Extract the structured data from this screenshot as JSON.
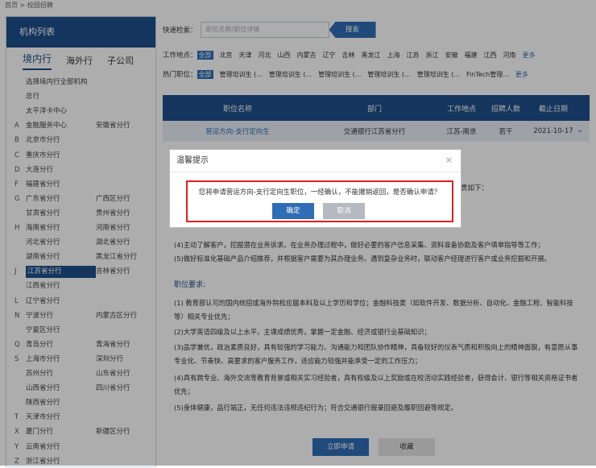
{
  "breadcrumb": "首页 > 校园招聘",
  "sidebar": {
    "title": "机构列表",
    "tabs": [
      "境内行",
      "海外行",
      "子公司"
    ],
    "rows": [
      {
        "letter": "",
        "c1": "选择境内行全部机构",
        "c2": ""
      },
      {
        "letter": "",
        "c1": "总行",
        "c2": ""
      },
      {
        "letter": "",
        "c1": "太平洋卡中心",
        "c2": ""
      },
      {
        "letter": "A",
        "c1": "金融服务中心",
        "c2": "安徽省分行"
      },
      {
        "letter": "B",
        "c1": "北京市分行",
        "c2": ""
      },
      {
        "letter": "C",
        "c1": "重庆市分行",
        "c2": ""
      },
      {
        "letter": "D",
        "c1": "大连分行",
        "c2": ""
      },
      {
        "letter": "F",
        "c1": "福建省分行",
        "c2": ""
      },
      {
        "letter": "G",
        "c1": "广东省分行",
        "c2": "广西区分行"
      },
      {
        "letter": "",
        "c1": "甘肃省分行",
        "c2": "贵州省分行"
      },
      {
        "letter": "H",
        "c1": "海南省分行",
        "c2": "河南省分行"
      },
      {
        "letter": "",
        "c1": "河北省分行",
        "c2": "湖北省分行"
      },
      {
        "letter": "",
        "c1": "湖南省分行",
        "c2": "黑龙江省分行"
      },
      {
        "letter": "J",
        "c1": "江苏省分行",
        "c2": "吉林省分行"
      },
      {
        "letter": "",
        "c1": "江西省分行",
        "c2": ""
      },
      {
        "letter": "L",
        "c1": "辽宁省分行",
        "c2": ""
      },
      {
        "letter": "N",
        "c1": "宁波分行",
        "c2": "内蒙古区分行"
      },
      {
        "letter": "",
        "c1": "宁夏区分行",
        "c2": ""
      },
      {
        "letter": "Q",
        "c1": "青岛分行",
        "c2": "青海省分行"
      },
      {
        "letter": "S",
        "c1": "上海市分行",
        "c2": "深圳分行"
      },
      {
        "letter": "",
        "c1": "苏州分行",
        "c2": "山东省分行"
      },
      {
        "letter": "",
        "c1": "山西省分行",
        "c2": "四川省分行"
      },
      {
        "letter": "",
        "c1": "陕西省分行",
        "c2": ""
      },
      {
        "letter": "T",
        "c1": "天津市分行",
        "c2": ""
      },
      {
        "letter": "X",
        "c1": "厦门分行",
        "c2": "新疆区分行"
      },
      {
        "letter": "Y",
        "c1": "云南省分行",
        "c2": ""
      },
      {
        "letter": "Z",
        "c1": "浙江省分行",
        "c2": ""
      }
    ]
  },
  "search": {
    "label": "快速检索：",
    "placeholder": "职位名称/职位详情",
    "button": "搜索"
  },
  "filters": {
    "location_label": "工作地点：",
    "locations": [
      "全部",
      "北京",
      "天津",
      "河北",
      "山西",
      "内蒙古",
      "辽宁",
      "吉林",
      "黑龙江",
      "上海",
      "江苏",
      "浙江",
      "安徽",
      "福建",
      "江西",
      "河南"
    ],
    "hot_label": "热门职位：",
    "hot": [
      "全部",
      "管理培训生 (...",
      "管理培训生 (...",
      "管理培训生 (...",
      "管理培训生 (...",
      "管理培训生 (...",
      "FinTech管理..."
    ],
    "more": "更多"
  },
  "table": {
    "headers": [
      "职位名称",
      "部门",
      "工作地点",
      "招聘人数",
      "截止日期"
    ],
    "row": [
      "营运方向-支行定向生",
      "交通银行江苏省分行",
      "江苏-南京",
      "若干",
      "2021-10-17"
    ]
  },
  "detail": {
    "fragment_right": "责如下：",
    "duty4": "(4)主动了解客户，挖掘潜在业务诉求。在业务办理过程中，做好必要的客户信息采集、资料准备协助及客户填单指导等工作；",
    "duty5": "(5)做好标准化基础产品介绍推荐，并根据客户需要为其办理业务。遇到复杂业务时，联动客户经理进行客户或业务挖掘和开展。",
    "req_title": "职位要求:",
    "req1": "(1) 教育部认可的国内统招或海外院校应届本科及以上学历和学位；金融科技类（如软件开发、数据分析、自动化、金融工程、智能科技等）相关专业优先；",
    "req2": "(2)大学英语四级及以上水平，主课成绩优秀，掌握一定金融、经济或银行业基础知识；",
    "req3": "(3)品学兼优，政治素质良好，具有较强的学习能力、沟通能力和团队协作精神，具备较好的仪表气质和积极向上的精神面貌，有意愿从事专业化、节奏快、高要求的客户服务工作，适应能力较强并能承受一定的工作压力；",
    "req4": "(4)具有跨专业、海外交流等教育背景或相关实习经验者，具有校级及以上奖励或在校活动实践经验者，获得会计、银行等相关资格证书者优先；",
    "req5": "(5)身体健康，品行端正，无任何违法违规违纪行为；符合交通银行报录回避及履职回避等规定。"
  },
  "buttons": {
    "apply": "立即申请",
    "favorite": "收藏"
  },
  "dialog": {
    "title": "温馨提示",
    "message": "您将申请营运方向-支行定向生职位，一经确认，不能撤销返回，是否确认申请？",
    "ok": "确定",
    "cancel": "取消"
  },
  "colors": {
    "primary": "#1e4f8a",
    "accent": "#2f6db5",
    "highlight": "#e02020"
  }
}
